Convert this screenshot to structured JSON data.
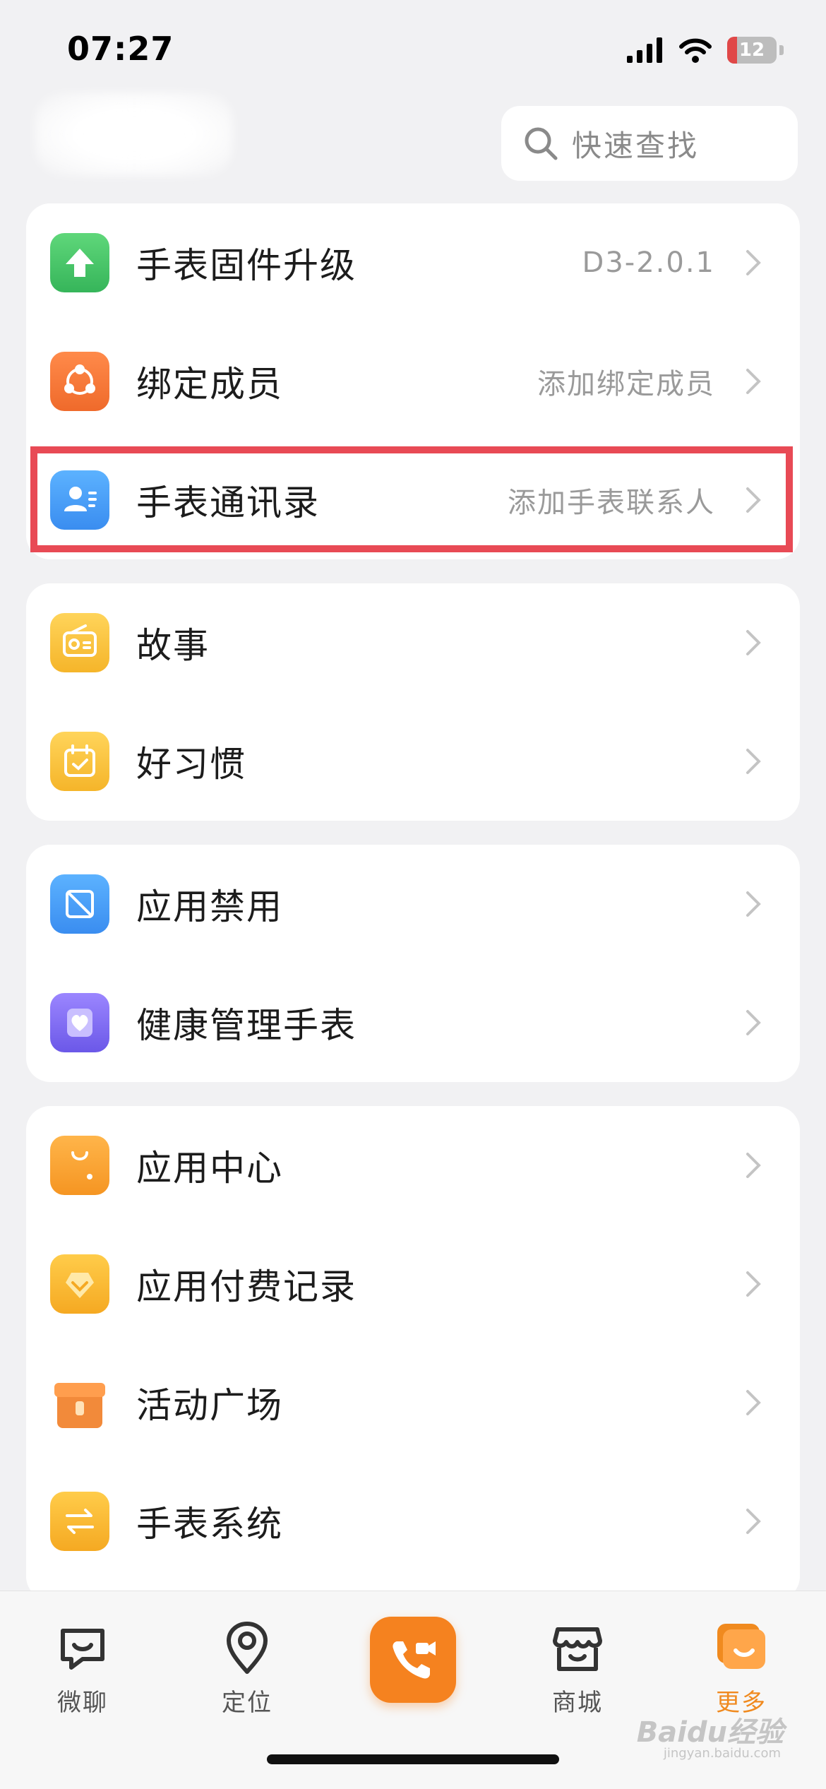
{
  "status_bar": {
    "time": "07:27",
    "battery": "12"
  },
  "header": {
    "search_placeholder": "快速查找"
  },
  "groups": [
    {
      "items": [
        {
          "label": "手表固件升级",
          "value": "D3-2.0.1"
        },
        {
          "label": "绑定成员",
          "value": "添加绑定成员"
        },
        {
          "label": "手表通讯录",
          "value": "添加手表联系人",
          "highlighted": true
        }
      ]
    },
    {
      "items": [
        {
          "label": "故事",
          "value": ""
        },
        {
          "label": "好习惯",
          "value": ""
        }
      ]
    },
    {
      "items": [
        {
          "label": "应用禁用",
          "value": ""
        },
        {
          "label": "健康管理手表",
          "value": ""
        }
      ]
    },
    {
      "items": [
        {
          "label": "应用中心",
          "value": ""
        },
        {
          "label": "应用付费记录",
          "value": ""
        },
        {
          "label": "活动广场",
          "value": ""
        },
        {
          "label": "手表系统",
          "value": ""
        }
      ]
    }
  ],
  "tab_bar": {
    "tabs": [
      {
        "label": "微聊",
        "icon": "chat-icon"
      },
      {
        "label": "定位",
        "icon": "location-icon"
      },
      {
        "label": "",
        "icon": "video-call-icon"
      },
      {
        "label": "商城",
        "icon": "store-icon"
      },
      {
        "label": "更多",
        "icon": "more-icon",
        "active": true
      }
    ],
    "active_color": "#f08a1f"
  },
  "watermark": {
    "text": "Baidu经验",
    "sub": "jingyan.baidu.com"
  }
}
